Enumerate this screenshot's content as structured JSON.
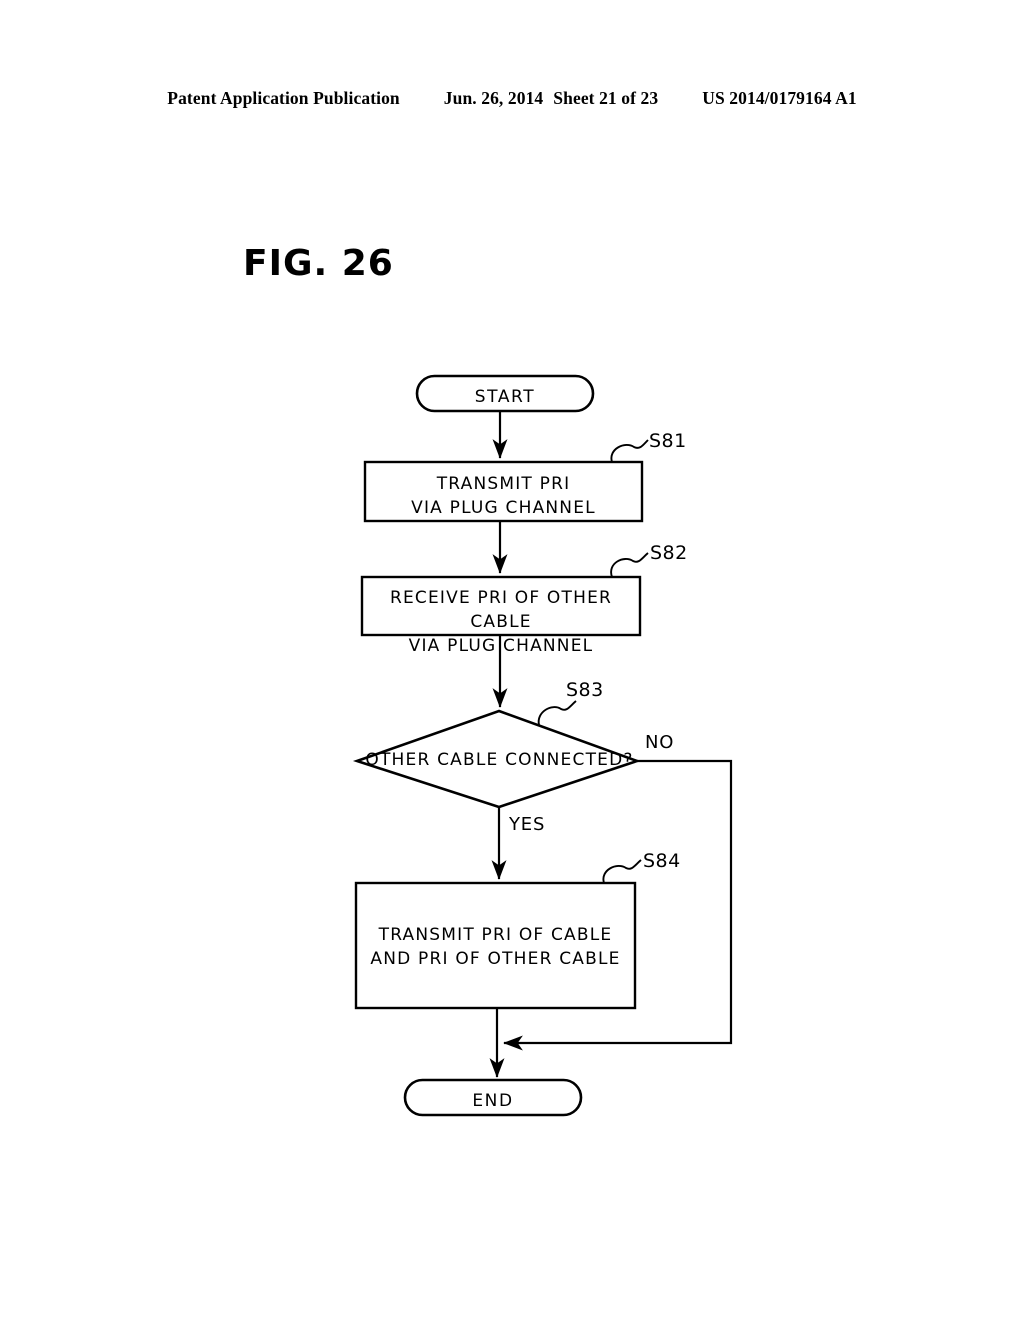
{
  "header": {
    "publication": "Patent Application Publication",
    "date": "Jun. 26, 2014",
    "sheet": "Sheet 21 of 23",
    "patent_number": "US 2014/0179164 A1"
  },
  "figure": {
    "title": "FIG. 26"
  },
  "flowchart": {
    "type": "flowchart",
    "nodes": [
      {
        "id": "start",
        "shape": "terminator",
        "text": "START"
      },
      {
        "id": "s81",
        "shape": "process",
        "tag": "S81",
        "text": "TRANSMIT PRI\nVIA PLUG CHANNEL"
      },
      {
        "id": "s82",
        "shape": "process",
        "tag": "S82",
        "text": "RECEIVE PRI OF OTHER CABLE\nVIA PLUG CHANNEL"
      },
      {
        "id": "s83",
        "shape": "decision",
        "tag": "S83",
        "text": "OTHER CABLE CONNECTED?"
      },
      {
        "id": "s84",
        "shape": "process",
        "tag": "S84",
        "text": "TRANSMIT PRI OF CABLE\nAND PRI OF OTHER CABLE"
      },
      {
        "id": "end",
        "shape": "terminator",
        "text": "END"
      }
    ],
    "branches": {
      "yes": "YES",
      "no": "NO"
    }
  }
}
